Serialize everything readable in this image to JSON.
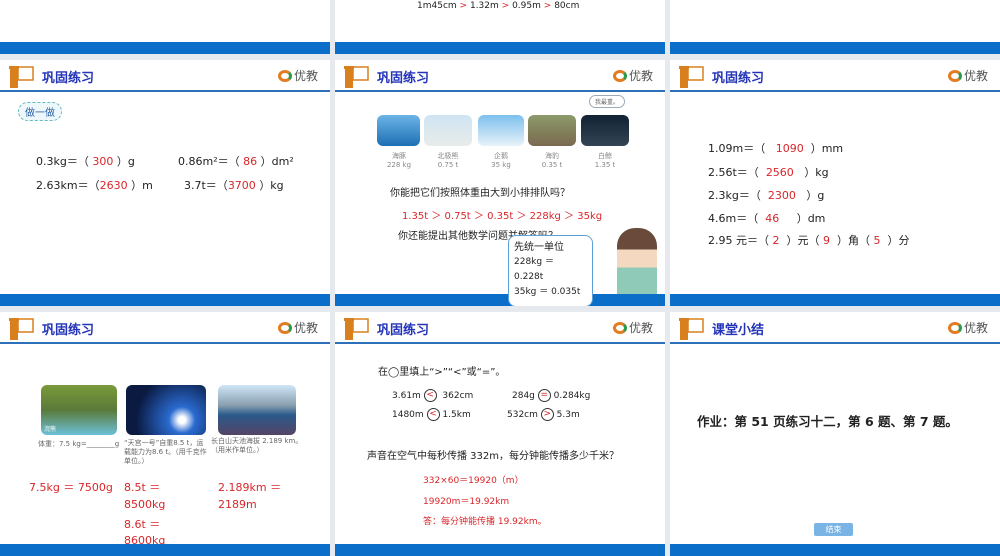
{
  "brand": "优教",
  "top_row": {
    "middle_line": [
      "1m45cm",
      ">",
      "1.32m",
      ">",
      "0.95m",
      ">",
      "80cm"
    ]
  },
  "s1": {
    "title": "巩固练习",
    "badge": "做一做",
    "rows": [
      [
        "0.3kg＝（",
        "300",
        "）g"
      ],
      [
        "0.86m²＝（",
        "86",
        "）dm²"
      ],
      [
        "2.63km＝（",
        "2630",
        "）m"
      ],
      [
        "3.7t＝（",
        "3700",
        "）kg"
      ]
    ]
  },
  "s2": {
    "title": "巩固练习",
    "speech": "我最重。",
    "animals": [
      {
        "name": "海豚",
        "weight": "228 kg"
      },
      {
        "name": "北极熊",
        "weight": "0.75 t"
      },
      {
        "name": "企鹅",
        "weight": "35 kg"
      },
      {
        "name": "海豹",
        "weight": "0.35 t"
      },
      {
        "name": "白鲸",
        "weight": "1.35 t"
      }
    ],
    "question": "你能把它们按照体重由大到小排排队吗？",
    "answer": "1.35t ＞ 0.75t ＞ 0.35t ＞ 228kg ＞ 35kg",
    "question2": "你还能提出其他数学问题并解答吗？",
    "bubble": [
      "先统一单位",
      "228kg ＝",
      "0.228t",
      "35kg ＝ 0.035t"
    ]
  },
  "s3": {
    "title": "巩固练习",
    "rows": [
      [
        "1.09m＝（",
        "1090",
        "）mm"
      ],
      [
        "2.56t＝（",
        "2560",
        "）kg"
      ],
      [
        "2.3kg＝（",
        "2300",
        "）g"
      ],
      [
        "4.6m＝（",
        "46",
        "）dm"
      ]
    ],
    "last": [
      "2.95 元＝（",
      "2",
      "）元（",
      "9",
      "）角（",
      "5",
      "）分"
    ]
  },
  "s4": {
    "title": "巩固练习",
    "img_label": "浣熊",
    "captions": [
      "体重：7.5 kg=________g",
      "“天宫一号”自重8.5 t，运载能力为8.6 t。（用千克作单位。）",
      "长白山天池海拔 2.189 km。（用米作单位。）"
    ],
    "answers": [
      "7.5kg ＝ 7500g",
      "8.5t ＝",
      "8500kg",
      "8.6t ＝",
      "8600kg",
      "2.189km ＝",
      "2189m"
    ]
  },
  "s5": {
    "title": "巩固练习",
    "instruction": "在◯里填上“>”“<”或“=”。",
    "items": [
      {
        "l": "3.61m",
        "s": "<",
        "r": "362cm"
      },
      {
        "l": "284g",
        "s": "=",
        "r": "0.284kg"
      },
      {
        "l": "1480m",
        "s": "<",
        "r": "1.5km"
      },
      {
        "l": "532cm",
        "s": ">",
        "r": "5.3m"
      }
    ],
    "problem": "声音在空气中每秒传播 332m，每分钟能传播多少千米？",
    "solution": [
      "332×60＝19920（m）",
      "19920m＝19.92km",
      "答：每分钟能传播 19.92km。"
    ]
  },
  "s6": {
    "title": "课堂小结",
    "homework": "作业：第 51 页练习十二，第 6 题、第 7 题。",
    "end_button": "结束"
  }
}
